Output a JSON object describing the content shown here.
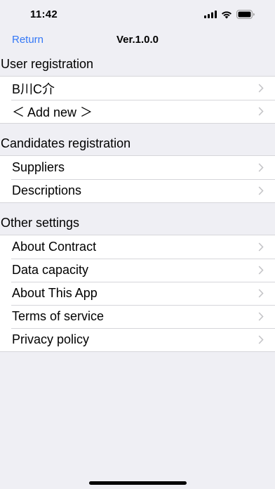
{
  "status_bar": {
    "time": "11:42",
    "icons": [
      "signal-icon",
      "wifi-icon",
      "battery-icon"
    ]
  },
  "nav": {
    "back_label": "Return",
    "title": "Ver.1.0.0"
  },
  "sections": {
    "user": {
      "header": "User registration",
      "items": [
        "B川C介",
        "＜ Add new ＞"
      ]
    },
    "candidates": {
      "header": "Candidates registration",
      "items": [
        "Suppliers",
        "Descriptions"
      ]
    },
    "other": {
      "header": "Other settings",
      "items": [
        "About Contract",
        "Data capacity",
        "About This App",
        "Terms of service",
        "Privacy policy"
      ]
    }
  },
  "colors": {
    "accent": "#3478f6",
    "background": "#efeff4",
    "chevron": "#c4c4c7"
  }
}
